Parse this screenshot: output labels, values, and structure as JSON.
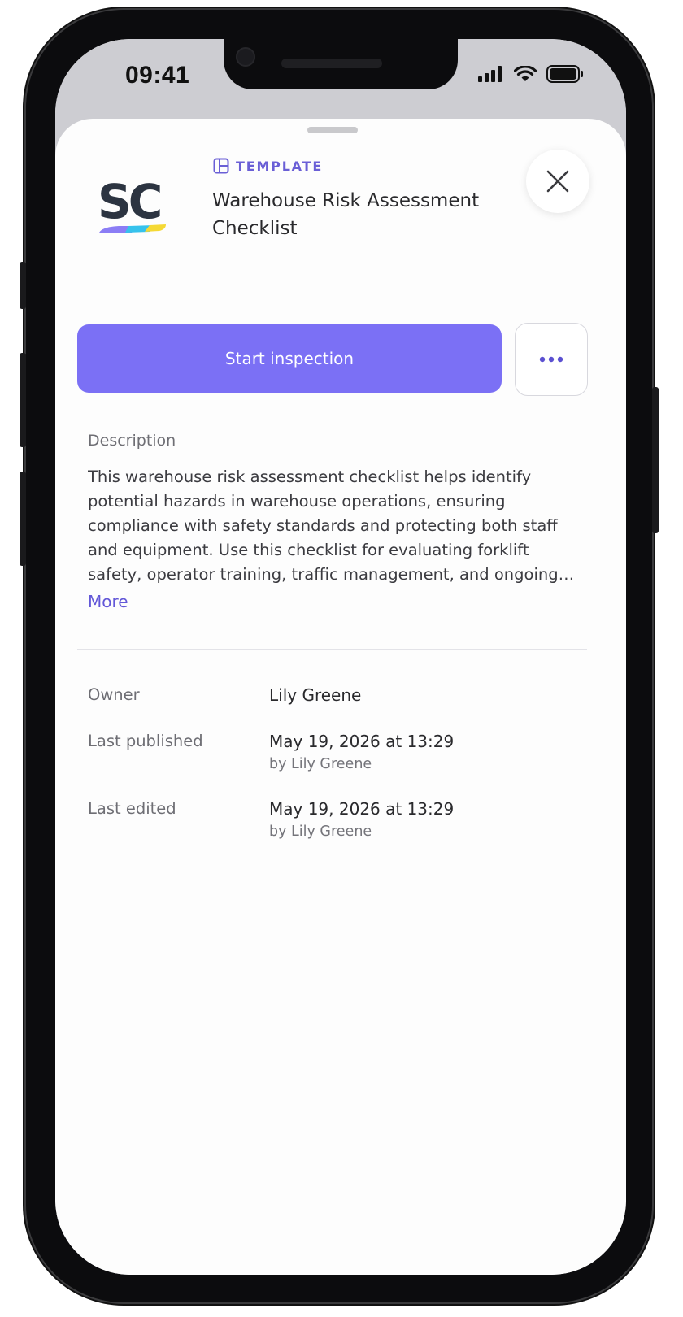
{
  "status_bar": {
    "time": "09:41"
  },
  "header": {
    "tag_icon": "template-icon",
    "tag_label": "TEMPLATE",
    "title": "Warehouse Risk Assessment Checklist",
    "logo_text": "SC",
    "close_icon": "close-icon"
  },
  "actions": {
    "start_label": "Start inspection",
    "more_icon": "ellipsis-icon"
  },
  "description": {
    "label": "Description",
    "text": "This warehouse risk assessment checklist helps identify potential hazards in warehouse operations, ensuring compliance with safety standards and protecting both staff and equipment. Use this checklist for evaluating forklift safety, operator training, traffic management, and ongoing maintenance.",
    "more_label": "More"
  },
  "details": {
    "owner_label": "Owner",
    "owner_value": "Lily Greene",
    "published_label": "Last published",
    "published_value": "May 19, 2026 at 13:29",
    "published_by": "by Lily Greene",
    "edited_label": "Last edited",
    "edited_value": "May 19, 2026 at 13:29",
    "edited_by": "by Lily Greene"
  },
  "colors": {
    "accent": "#7b70f5",
    "accent_text": "#6358d8",
    "tag": "#6a5fd6"
  }
}
